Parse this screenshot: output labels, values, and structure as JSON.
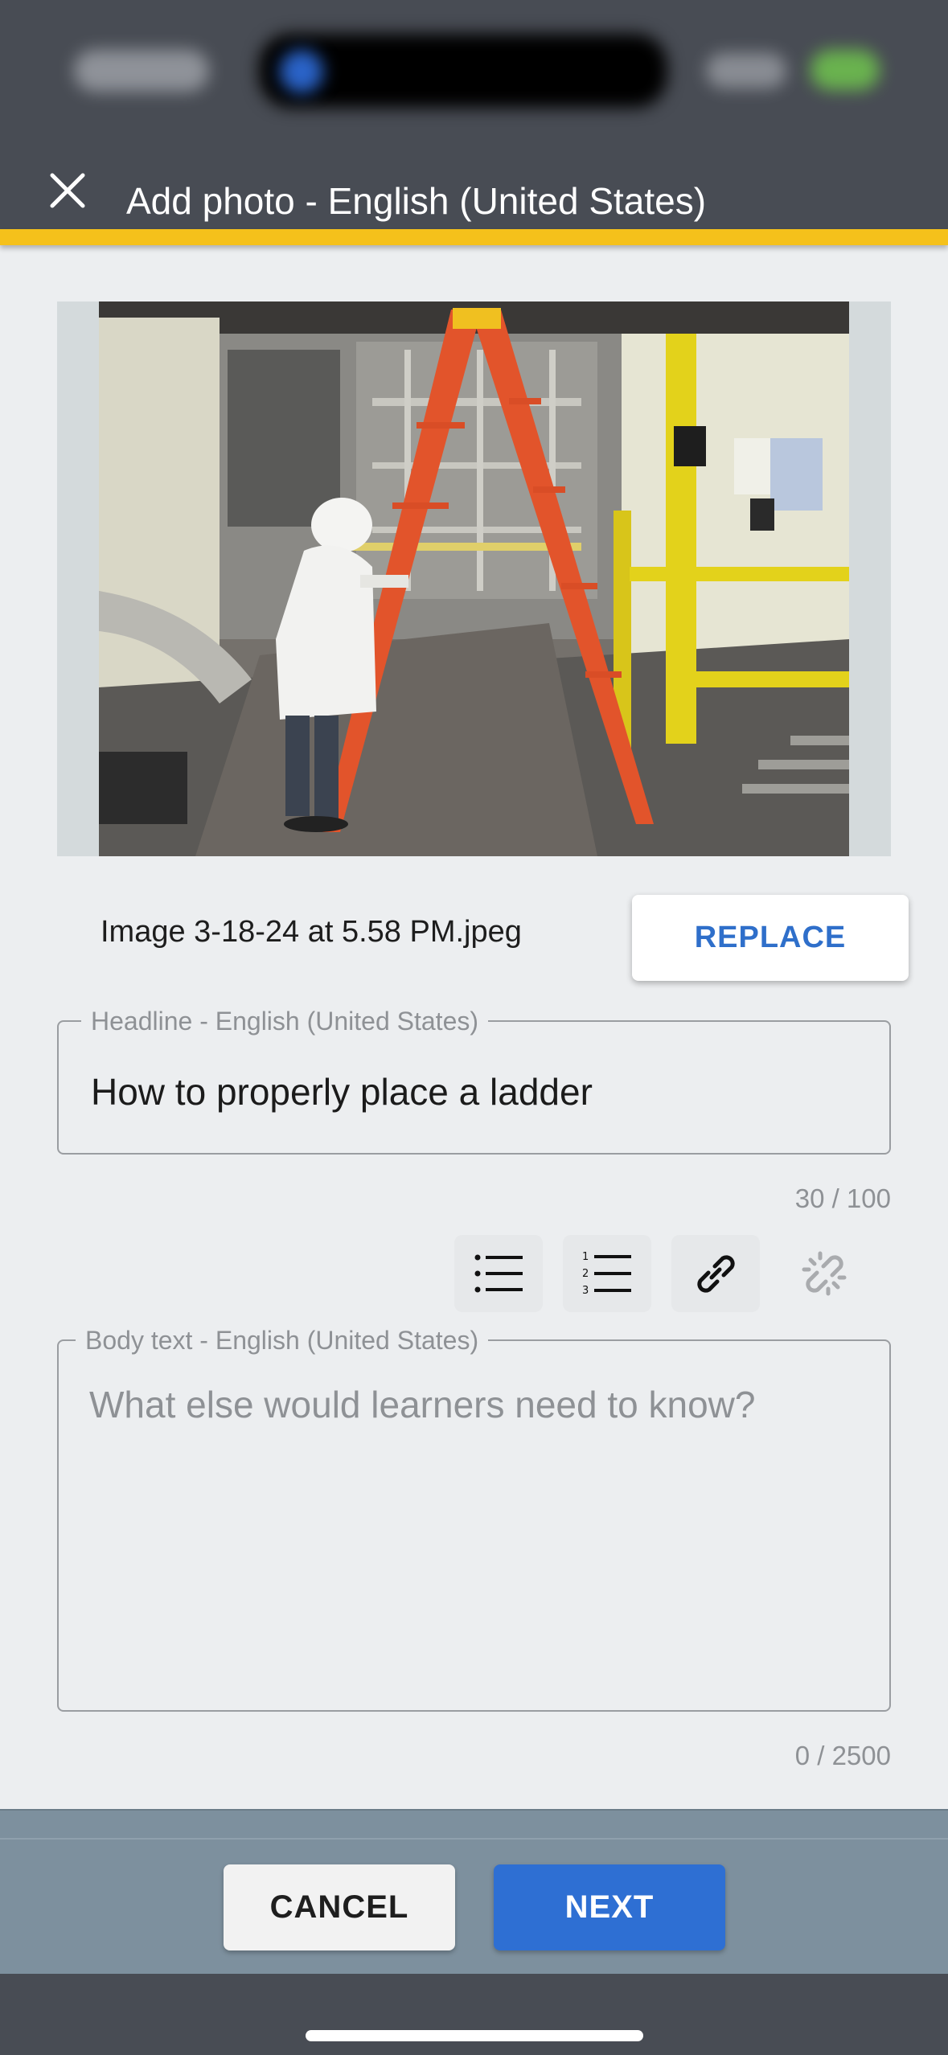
{
  "header": {
    "title": "Add photo - English (United States)",
    "close_icon": "close-icon",
    "accent_color": "#f5c11b"
  },
  "image": {
    "filename": "Image 3-18-24 at 5.58 PM.jpeg",
    "replace_label": "REPLACE"
  },
  "headline": {
    "label": "Headline - English (United States)",
    "value": "How to properly place a ladder",
    "counter": "30 / 100"
  },
  "toolbar": {
    "buttons": [
      {
        "icon": "bulleted-list-icon"
      },
      {
        "icon": "numbered-list-icon"
      },
      {
        "icon": "link-icon"
      },
      {
        "icon": "unlink-icon"
      }
    ]
  },
  "body": {
    "label": "Body text - English (United States)",
    "placeholder": "What else would learners need to know?",
    "counter": "0 / 2500"
  },
  "actions": {
    "cancel_label": "CANCEL",
    "next_label": "NEXT",
    "primary_color": "#2e6fd3"
  }
}
